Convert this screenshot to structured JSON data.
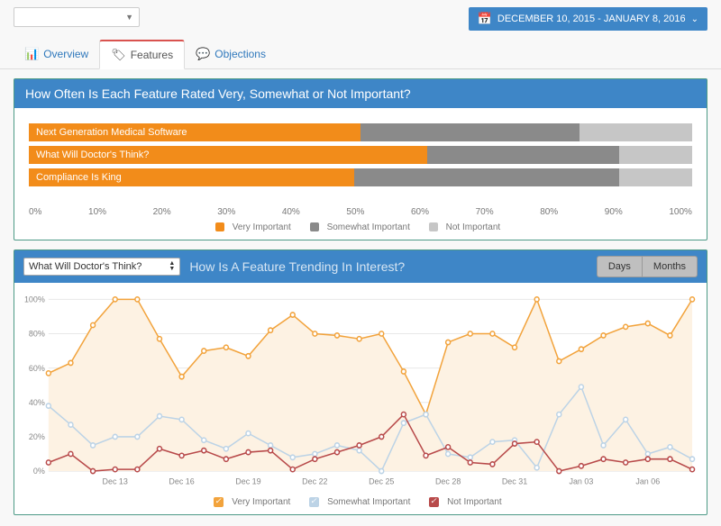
{
  "daterange": {
    "label": "DECEMBER 10, 2015 - JANUARY 8, 2016"
  },
  "tabs": {
    "overview": "Overview",
    "features": "Features",
    "objections": "Objections"
  },
  "panel1": {
    "title": "How Often Is Each Feature Rated Very, Somewhat or Not Important?",
    "legend": {
      "very": "Very Important",
      "somewhat": "Somewhat Important",
      "not": "Not Important"
    },
    "xticks": [
      "0%",
      "10%",
      "20%",
      "30%",
      "40%",
      "50%",
      "60%",
      "70%",
      "80%",
      "90%",
      "100%"
    ]
  },
  "panel2": {
    "selected_feature": "What Will Doctor's Think?",
    "title": "How Is A Feature Trending In Interest?",
    "btn_days": "Days",
    "btn_months": "Months",
    "legend": {
      "very": "Very Important",
      "somewhat": "Somewhat Important",
      "not": "Not Important"
    },
    "yticks": [
      "0%",
      "20%",
      "40%",
      "60%",
      "80%",
      "100%"
    ]
  },
  "chart_data": [
    {
      "type": "bar",
      "orientation": "horizontal-stacked",
      "title": "How Often Is Each Feature Rated Very, Somewhat or Not Important?",
      "categories": [
        "Next Generation Medical Software",
        "What Will Doctor's Think?",
        "Compliance Is King"
      ],
      "series": [
        {
          "name": "Very Important",
          "values": [
            50,
            60,
            49
          ]
        },
        {
          "name": "Somewhat Important",
          "values": [
            33,
            29,
            40
          ]
        },
        {
          "name": "Not Important",
          "values": [
            17,
            11,
            11
          ]
        }
      ],
      "xlabel": "",
      "ylabel": "",
      "xlim": [
        0,
        100
      ],
      "unit": "%"
    },
    {
      "type": "line",
      "title": "How Is A Feature Trending In Interest?",
      "feature": "What Will Doctor's Think?",
      "x": [
        "Dec 10",
        "Dec 11",
        "Dec 12",
        "Dec 13",
        "Dec 14",
        "Dec 15",
        "Dec 16",
        "Dec 17",
        "Dec 18",
        "Dec 19",
        "Dec 20",
        "Dec 21",
        "Dec 22",
        "Dec 23",
        "Dec 24",
        "Dec 25",
        "Dec 26",
        "Dec 27",
        "Dec 28",
        "Dec 29",
        "Dec 30",
        "Dec 31",
        "Jan 01",
        "Jan 02",
        "Jan 03",
        "Jan 04",
        "Jan 05",
        "Jan 06",
        "Jan 07",
        "Jan 08"
      ],
      "x_ticks_shown": [
        "Dec 13",
        "Dec 16",
        "Dec 19",
        "Dec 22",
        "Dec 25",
        "Dec 28",
        "Dec 31",
        "Jan 03",
        "Jan 06"
      ],
      "series": [
        {
          "name": "Very Important",
          "values": [
            57,
            63,
            85,
            100,
            100,
            77,
            55,
            70,
            72,
            67,
            82,
            91,
            80,
            79,
            77,
            80,
            58,
            33,
            75,
            80,
            80,
            72,
            100,
            64,
            71,
            79,
            84,
            86,
            79,
            100
          ]
        },
        {
          "name": "Somewhat Important",
          "values": [
            38,
            27,
            15,
            20,
            20,
            32,
            30,
            18,
            13,
            22,
            15,
            8,
            10,
            15,
            12,
            0,
            28,
            33,
            10,
            8,
            17,
            18,
            2,
            33,
            49,
            15,
            30,
            10,
            14,
            7
          ]
        },
        {
          "name": "Not Important",
          "values": [
            5,
            10,
            0,
            1,
            1,
            13,
            9,
            12,
            7,
            11,
            12,
            1,
            7,
            11,
            15,
            20,
            33,
            9,
            14,
            5,
            4,
            16,
            17,
            0,
            3,
            7,
            5,
            7,
            7,
            1
          ]
        }
      ],
      "ylabel": "",
      "ylim": [
        0,
        100
      ],
      "unit": "%"
    }
  ]
}
